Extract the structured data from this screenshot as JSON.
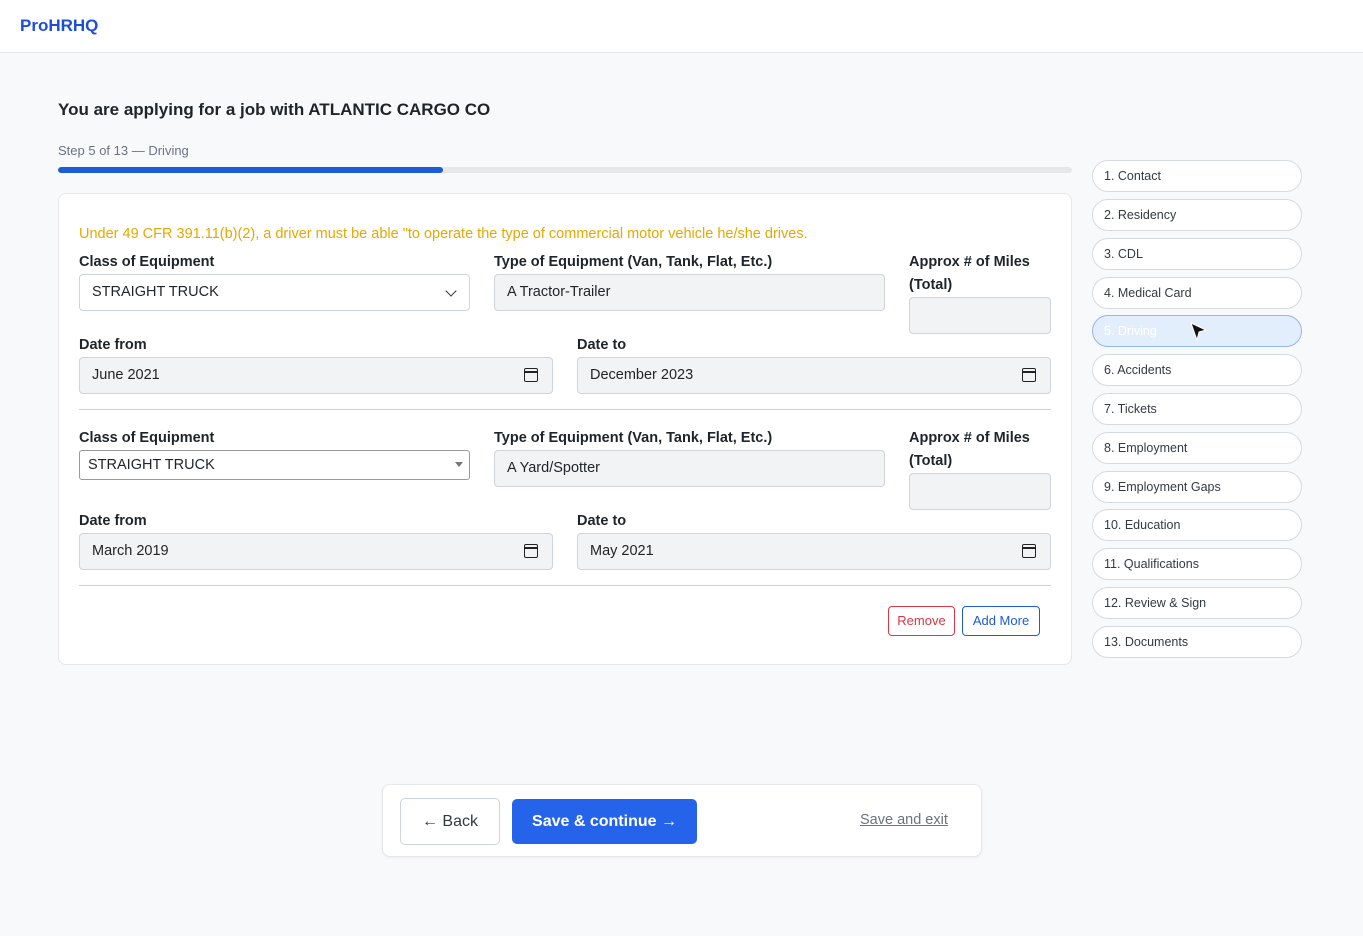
{
  "header": {
    "brand": "ProHRHQ"
  },
  "page": {
    "title": "You are applying for a job with ATLANTIC CARGO CO",
    "step_label": "Step 5 of 13 — Driving",
    "progress_fraction": 0.38
  },
  "form": {
    "notice": "Under 49 CFR 391.11(b)(2), a driver must be able \"to operate the type of commercial motor vehicle he/she drives.",
    "labels": {
      "class": "Class of Equipment",
      "type": "Type of Equipment (Van, Tank, Flat, Etc.)",
      "miles_line1": "Approx # of Miles",
      "miles_line2": "(Total)",
      "date_from": "Date from",
      "date_to": "Date to"
    },
    "entries": [
      {
        "class": "STRAIGHT TRUCK",
        "type": "A Tractor-Trailer",
        "miles": "",
        "date_from": "June 2021",
        "date_to": "December 2023"
      },
      {
        "class": "STRAIGHT TRUCK",
        "type": "A Yard/Spotter",
        "miles": "",
        "date_from": "March 2019",
        "date_to": "May 2021"
      }
    ],
    "remove_label": "Remove",
    "add_more_label": "Add More"
  },
  "steps": [
    {
      "label": "1. Contact"
    },
    {
      "label": "2. Residency"
    },
    {
      "label": "3. CDL"
    },
    {
      "label": "4. Medical Card"
    },
    {
      "label": "5. Driving",
      "active": true
    },
    {
      "label": "6. Accidents"
    },
    {
      "label": "7. Tickets"
    },
    {
      "label": "8. Employment"
    },
    {
      "label": "9. Employment Gaps"
    },
    {
      "label": "10. Education"
    },
    {
      "label": "11. Qualifications"
    },
    {
      "label": "12. Review & Sign"
    },
    {
      "label": "13. Documents"
    }
  ],
  "footer": {
    "back_label": "← Back",
    "save_label": "Save & continue →",
    "exit_label": "Save and exit"
  },
  "colors": {
    "accent": "#2563eb",
    "notice": "#e5a800",
    "danger": "#dc3545"
  },
  "icons": [
    "chevron-down-icon",
    "calendar-icon",
    "mouse-cursor-icon"
  ]
}
